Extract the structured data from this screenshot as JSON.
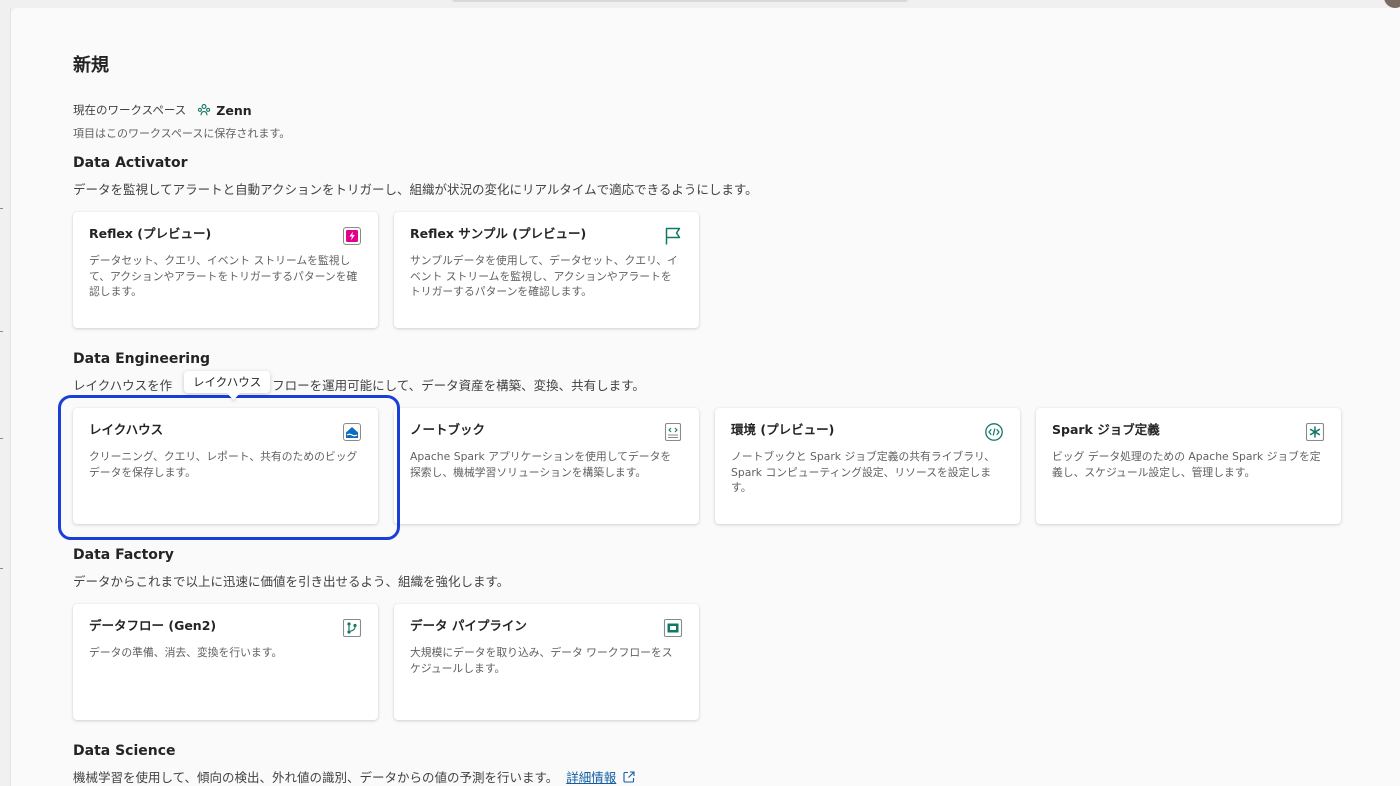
{
  "page": {
    "title": "新規",
    "workspace_label": "現在のワークスペース",
    "workspace_name": "Zenn",
    "workspace_hint": "項目はこのワークスペースに保存されます。"
  },
  "sections": [
    {
      "title": "Data Activator",
      "description": "データを監視してアラートと自動アクションをトリガーし、組織が状況の変化にリアルタイムで適応できるようにします。",
      "items": [
        {
          "title": "Reflex (プレビュー)",
          "description": "データセット、クエリ、イベント ストリームを監視して、アクションやアラートをトリガーするパターンを確認します。",
          "icon": "reflex-icon"
        },
        {
          "title": "Reflex サンプル (プレビュー)",
          "description": "サンプルデータを使用して、データセット、クエリ、イベント ストリームを監視し、アクションやアラートをトリガーするパターンを確認します。",
          "icon": "flag-icon"
        }
      ]
    },
    {
      "title": "Data Engineering",
      "description": "レイクハウスを作成し、データフローを運用可能にして、データ資産を構築、変換、共有します。",
      "description_visible": [
        "レイクハウスを作",
        "フローを運用可能にして、データ資産を構築、変換、共有します。"
      ],
      "items": [
        {
          "title": "レイクハウス",
          "description": "クリーニング、クエリ、レポート、共有のためのビッグ データを保存します。",
          "icon": "lakehouse-icon"
        },
        {
          "title": "ノートブック",
          "description": "Apache Spark アプリケーションを使用してデータを探索し、機械学習ソリューションを構築します。",
          "icon": "notebook-icon"
        },
        {
          "title": "環境 (プレビュー)",
          "description": "ノートブックと Spark ジョブ定義の共有ライブラリ、Spark コンピューティング設定、リソースを設定します。",
          "icon": "environment-icon"
        },
        {
          "title": "Spark ジョブ定義",
          "description": "ビッグ データ処理のための Apache Spark ジョブを定義し、スケジュール設定し、管理します。",
          "icon": "spark-job-icon"
        }
      ]
    },
    {
      "title": "Data Factory",
      "description": "データからこれまで以上に迅速に価値を引き出せるよう、組織を強化します。",
      "items": [
        {
          "title": "データフロー (Gen2)",
          "description": "データの準備、消去、変換を行います。",
          "icon": "dataflow-icon"
        },
        {
          "title": "データ パイプライン",
          "description": "大規模にデータを取り込み、データ ワークフローをスケジュールします。",
          "icon": "pipeline-icon"
        }
      ]
    },
    {
      "title": "Data Science",
      "description": "機械学習を使用して、傾向の検出、外れ値の識別、データからの値の予測を行います。",
      "link_label": "詳細情報"
    }
  ],
  "tooltip": {
    "text": "レイクハウス"
  },
  "colors": {
    "accent_green": "#117865",
    "highlight_blue": "#1a3fd9",
    "reflex_pink": "#e3008c",
    "lakehouse_blue": "#0f6cbd",
    "link_blue": "#115ea3"
  }
}
